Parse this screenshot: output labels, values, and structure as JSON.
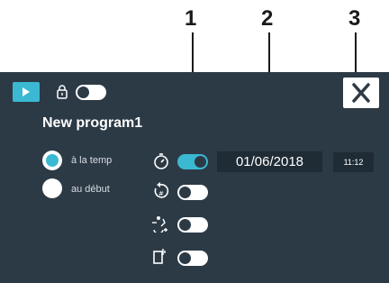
{
  "callouts": [
    "1",
    "2",
    "3"
  ],
  "header": {
    "play_icon": "play-icon",
    "lock_icon": "lock-icon",
    "lock_toggle_on": false,
    "close_icon": "close-icon"
  },
  "program": {
    "name": "New program1"
  },
  "start_options": [
    {
      "label": "à la temp",
      "selected": true
    },
    {
      "label": "au début",
      "selected": false
    }
  ],
  "settings": [
    {
      "icon": "timer-icon",
      "on": true
    },
    {
      "icon": "repeat-icon",
      "on": false
    },
    {
      "icon": "walk-icon",
      "on": false
    },
    {
      "icon": "door-icon",
      "on": false
    }
  ],
  "schedule": {
    "date": "01/06/2018",
    "time": "11:12"
  },
  "colors": {
    "panel": "#2c3a46",
    "accent": "#3bb8d2",
    "field": "#1f2b35"
  }
}
